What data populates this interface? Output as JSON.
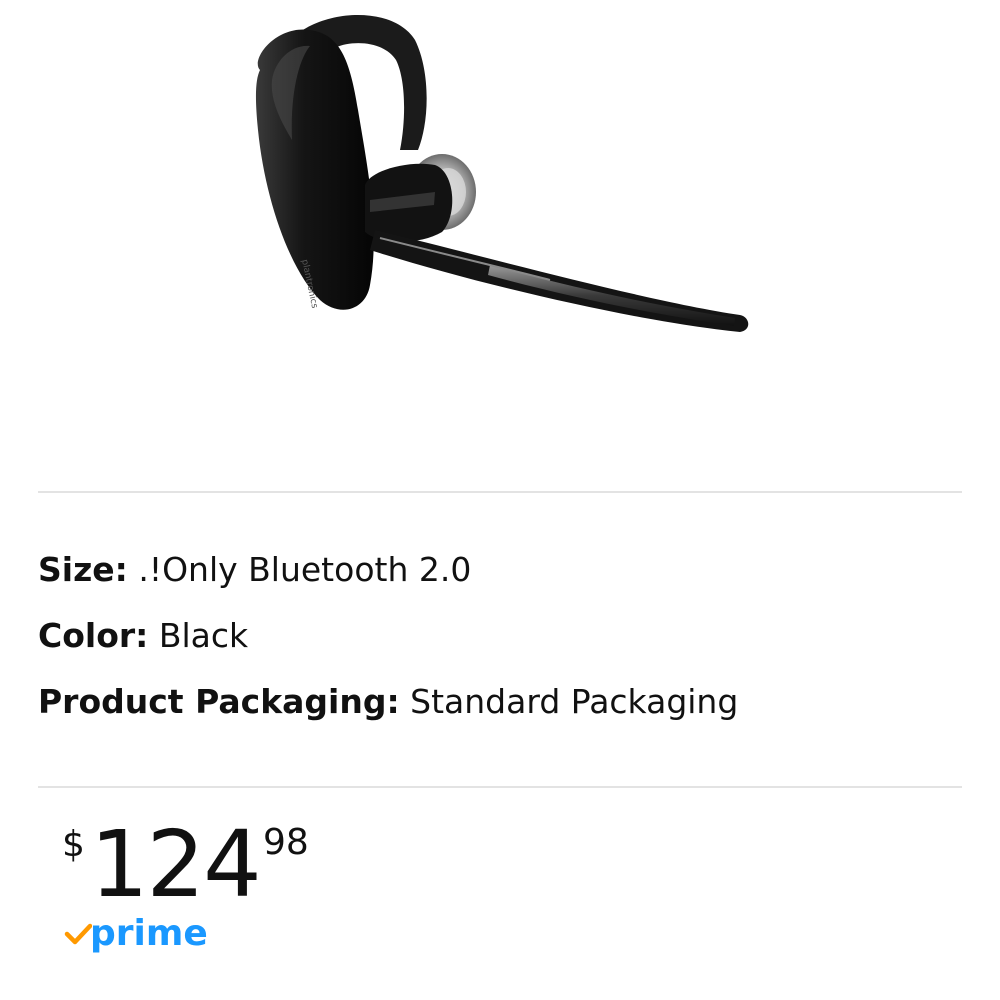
{
  "product_image": {
    "icon": "bluetooth-headset-image"
  },
  "variations": [
    {
      "label": "Size:",
      "value": " .!Only Bluetooth 2.0"
    },
    {
      "label": "Color:",
      "value": " Black"
    },
    {
      "label": "Product Packaging:",
      "value": " Standard Packaging"
    }
  ],
  "price": {
    "currency": "$",
    "whole": "124",
    "fraction": "98"
  },
  "prime": {
    "label": "prime",
    "icon": "prime-check-icon",
    "color": "#1a98ff",
    "check_color": "#f90"
  }
}
